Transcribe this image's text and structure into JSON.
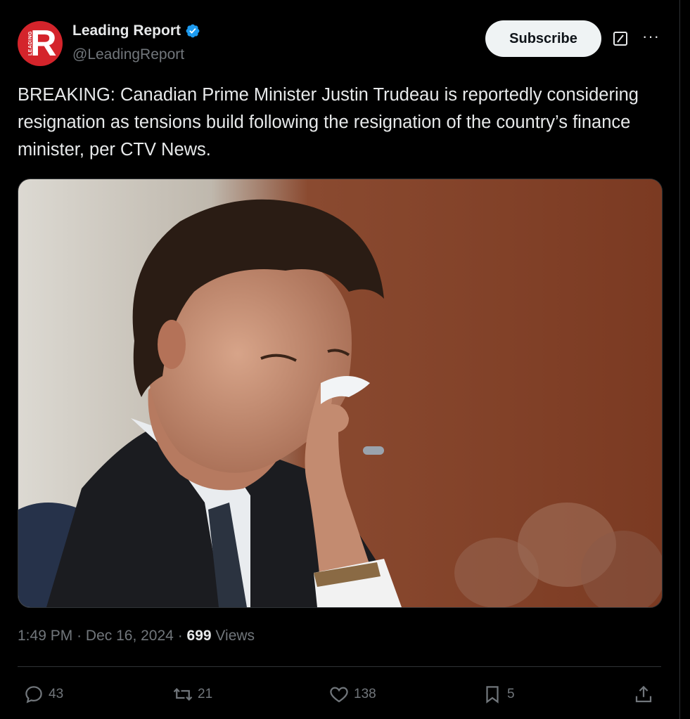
{
  "account": {
    "name": "Leading Report",
    "handle": "@LeadingReport",
    "avatar_letter": "R",
    "avatar_small_text": "LEADING",
    "avatar_color": "#d4242b",
    "verified_color": "#1d9bf0"
  },
  "header": {
    "subscribe_label": "Subscribe",
    "more_label": "···"
  },
  "post": {
    "text": "BREAKING: Canadian Prime Minister Justin Trudeau is reportedly considering resignation as tensions build following the resignation of the country’s finance minister, per CTV News.",
    "time": "1:49 PM",
    "date": "Dec 16, 2024",
    "separator": "·",
    "views_count": "699",
    "views_label": "Views"
  },
  "actions": {
    "replies": "43",
    "reposts": "21",
    "likes": "138",
    "bookmarks": "5"
  }
}
